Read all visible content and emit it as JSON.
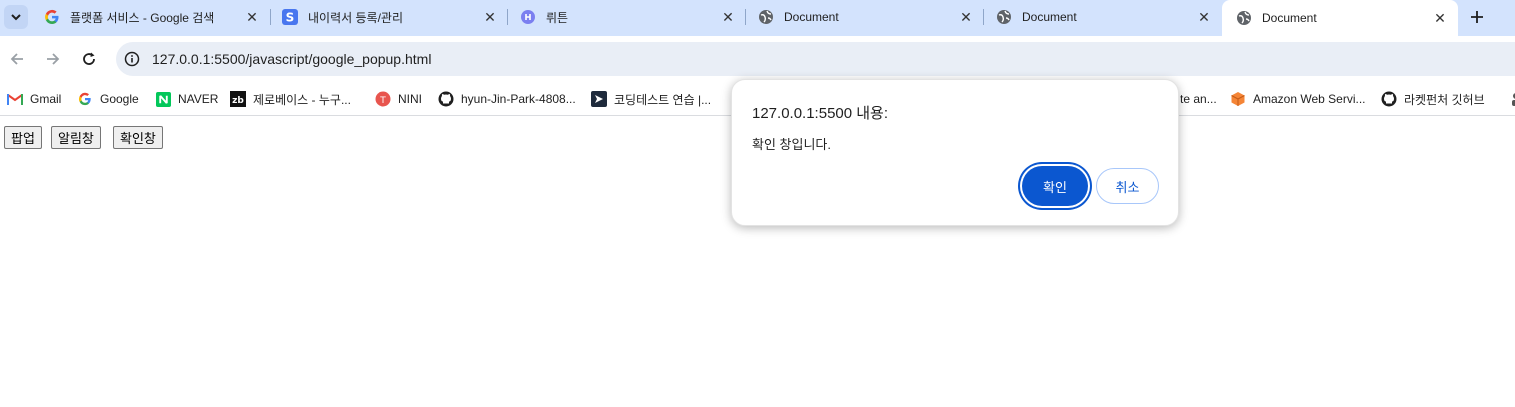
{
  "tabs": [
    {
      "title": "플랫폼 서비스 - Google 검색",
      "icon": "google-g-icon",
      "active": false
    },
    {
      "title": "내이력서 등록/관리",
      "icon": "saramin-s-icon",
      "active": false
    },
    {
      "title": "뤼튼",
      "icon": "wrtn-icon",
      "active": false
    },
    {
      "title": "Document",
      "icon": "globe-icon",
      "active": false
    },
    {
      "title": "Document",
      "icon": "globe-icon",
      "active": false
    },
    {
      "title": "Document",
      "icon": "globe-icon",
      "active": true
    }
  ],
  "address_bar": {
    "url": "127.0.0.1:5500/javascript/google_popup.html"
  },
  "bookmarks": [
    {
      "label": "Gmail",
      "icon": "gmail-icon"
    },
    {
      "label": "Google",
      "icon": "google-g-icon"
    },
    {
      "label": "NAVER",
      "icon": "naver-icon"
    },
    {
      "label": "제로베이스 - 누구...",
      "icon": "zerobase-icon"
    },
    {
      "label": "NINI",
      "icon": "nini-icon"
    },
    {
      "label": "hyun-Jin-Park-4808...",
      "icon": "github-icon"
    },
    {
      "label": "코딩테스트 연습 |...",
      "icon": "programmers-icon"
    },
    {
      "label": "te an...",
      "icon": ""
    },
    {
      "label": "Amazon Web Servi...",
      "icon": "aws-icon"
    },
    {
      "label": "라켓펀처 깃허브",
      "icon": "github-icon"
    }
  ],
  "page_buttons": {
    "popup": "팝업",
    "alert": "알림창",
    "confirm": "확인창"
  },
  "dialog": {
    "title": "127.0.0.1:5500 내용:",
    "message": "확인 창입니다.",
    "ok_label": "확인",
    "cancel_label": "취소"
  },
  "colors": {
    "accent": "#0b57d0",
    "tabstrip": "#d3e3fd",
    "omnibox": "#e9eef6"
  }
}
